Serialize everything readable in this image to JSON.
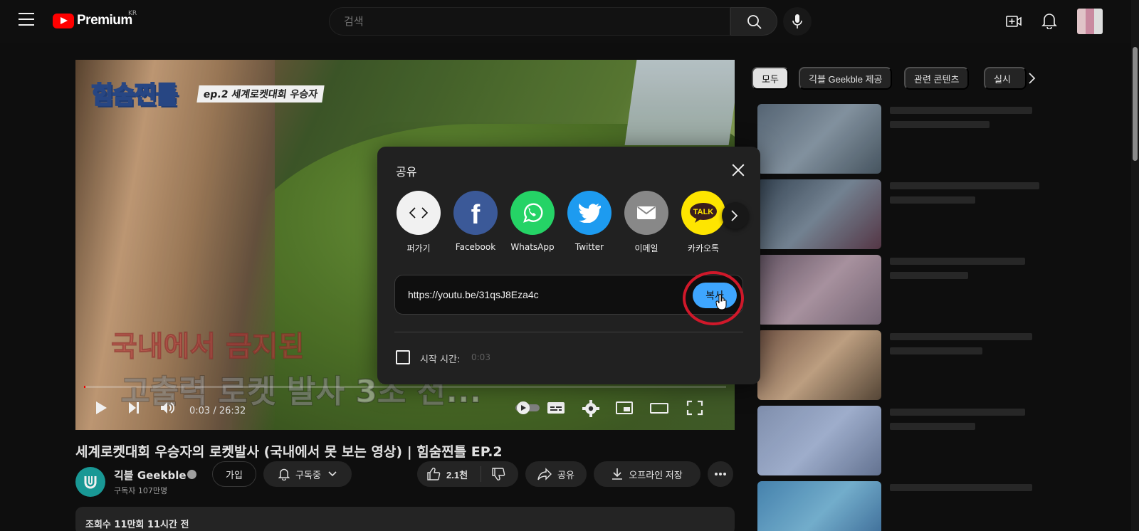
{
  "header": {
    "logo_text": "Premium",
    "region": "KR",
    "search_placeholder": "검색"
  },
  "player": {
    "overlay_title": "힘숨찐틀",
    "overlay_subtitle": "ep.2 세계로켓대회 우승자",
    "caption_line1": "국내에서 금지된",
    "caption_line2": "고출력 로켓 발사 3초 전...",
    "time": "0:03 / 26:32",
    "progress_fraction": 0.002
  },
  "video": {
    "title": "세계로켓대회 우승자의 로켓발사 (국내에서 못 보는 영상) | 힘숨찐틀 EP.2",
    "channel": "긱블 Geekble",
    "subscribers": "구독자 107만명",
    "join_label": "가입",
    "subscribed_label": "구독중",
    "likes": "2.1천",
    "share_label": "공유",
    "download_label": "오프라인 저장",
    "views_label": "조회수 11만회  11시간 전"
  },
  "sidebar": {
    "chips": [
      "모두",
      "긱블 Geekble 제공",
      "관련 콘텐츠",
      "실시"
    ]
  },
  "share_dialog": {
    "title": "공유",
    "targets": [
      {
        "label": "퍼가기",
        "icon": "embed-icon",
        "color": "#f1f1f1"
      },
      {
        "label": "Facebook",
        "icon": "facebook-icon",
        "color": "#3b5998"
      },
      {
        "label": "WhatsApp",
        "icon": "whatsapp-icon",
        "color": "#25d366"
      },
      {
        "label": "Twitter",
        "icon": "twitter-icon",
        "color": "#1d9bf0"
      },
      {
        "label": "이메일",
        "icon": "email-icon",
        "color": "#888888"
      },
      {
        "label": "카카오톡",
        "icon": "kakaotalk-icon",
        "color": "#fee500"
      }
    ],
    "url": "https://youtu.be/31qsJ8Eza4c",
    "copy_label": "복사",
    "start_time_label": "시작 시간:",
    "start_time_value": "0:03"
  }
}
